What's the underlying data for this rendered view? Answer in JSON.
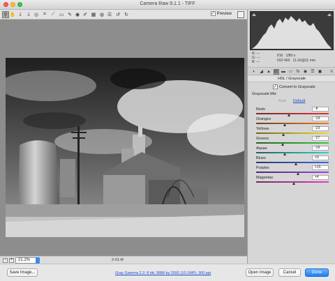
{
  "window": {
    "title": "Camera Raw 9.1.1  -  TIFF"
  },
  "toolbar": {
    "preview_label": "Preview",
    "preview_checked": true,
    "tools": [
      {
        "name": "zoom-tool",
        "glyph": "⚲"
      },
      {
        "name": "hand-tool",
        "glyph": "✋"
      },
      {
        "name": "white-balance-tool",
        "glyph": "⤓"
      },
      {
        "name": "color-sampler-tool",
        "glyph": "⤓"
      },
      {
        "name": "targeted-adjustment-tool",
        "glyph": "◎"
      },
      {
        "name": "crop-tool",
        "glyph": "⌗"
      },
      {
        "name": "straighten-tool",
        "glyph": "⟋"
      },
      {
        "name": "transform-tool",
        "glyph": "▭"
      },
      {
        "name": "spot-removal-tool",
        "glyph": "✎"
      },
      {
        "name": "red-eye-tool",
        "glyph": "◉"
      },
      {
        "name": "adjustment-brush-tool",
        "glyph": "✐"
      },
      {
        "name": "graduated-filter-tool",
        "glyph": "▦"
      },
      {
        "name": "radial-filter-tool",
        "glyph": "◍"
      },
      {
        "name": "preferences-tool",
        "glyph": "☰"
      },
      {
        "name": "rotate-left-tool",
        "glyph": "↺"
      },
      {
        "name": "rotate-right-tool",
        "glyph": "↻"
      }
    ]
  },
  "readout": {
    "r_label": "R:",
    "r_value": "---",
    "g_label": "G:",
    "g_value": "---",
    "b_label": "B:",
    "b_value": "---",
    "aperture": "f/16",
    "shutter": "1/80 s",
    "iso": "ISO 400",
    "lens": "11-16@11 mm"
  },
  "panel_tabs": [
    {
      "name": "basic-tab",
      "glyph": "◐"
    },
    {
      "name": "tone-curve-tab",
      "glyph": "◢"
    },
    {
      "name": "detail-tab",
      "glyph": "▲"
    },
    {
      "name": "hsl-grayscale-tab",
      "glyph": "▤"
    },
    {
      "name": "split-toning-tab",
      "glyph": "▬"
    },
    {
      "name": "lens-corrections-tab",
      "glyph": "▭"
    },
    {
      "name": "effects-tab",
      "glyph": "fx"
    },
    {
      "name": "camera-calibration-tab",
      "glyph": "◉"
    },
    {
      "name": "presets-tab",
      "glyph": "☰"
    },
    {
      "name": "snapshots-tab",
      "glyph": "▣"
    }
  ],
  "panel": {
    "section_title": "HSL / Grayscale",
    "convert_label": "Convert to Grayscale",
    "convert_checked": true,
    "mix_title": "Grayscale Mix",
    "auto_label": "Auto",
    "default_label": "Default"
  },
  "sliders": [
    {
      "label": "Reds",
      "value": "-8",
      "fraction": 0.46,
      "gradient": [
        "#7a2a2a",
        "#e53030"
      ]
    },
    {
      "label": "Oranges",
      "value": "-19",
      "fraction": 0.4,
      "gradient": [
        "#6e4120",
        "#f07a1a"
      ]
    },
    {
      "label": "Yellows",
      "value": "-23",
      "fraction": 0.38,
      "gradient": [
        "#6b6a1e",
        "#f0dc1e"
      ]
    },
    {
      "label": "Greens",
      "value": "-27",
      "fraction": 0.37,
      "gradient": [
        "#2c5e2a",
        "#36c83a"
      ]
    },
    {
      "label": "Aquas",
      "value": "-19",
      "fraction": 0.4,
      "gradient": [
        "#245e5e",
        "#2fd0d0"
      ]
    },
    {
      "label": "Blues",
      "value": "+9",
      "fraction": 0.55,
      "gradient": [
        "#283a6e",
        "#3366ee"
      ]
    },
    {
      "label": "Purples",
      "value": "+15",
      "fraction": 0.58,
      "gradient": [
        "#4a2a6e",
        "#9c40f0"
      ]
    },
    {
      "label": "Magentas",
      "value": "+4",
      "fraction": 0.52,
      "gradient": [
        "#6e2a5c",
        "#e83ac4"
      ]
    }
  ],
  "status": {
    "zoom": "21.2%",
    "filename": "2-01.tif"
  },
  "footer": {
    "save_label": "Save Image...",
    "workflow_link": "Gray Gamma 2.2; 8 bit; 3888 by 2592 (10.1MP); 300 ppi",
    "open_label": "Open Image",
    "cancel_label": "Cancel",
    "done_label": "Done"
  },
  "colors": {
    "accent": "#1f7ff0",
    "link": "#1a4fd0",
    "canvas_bg": "#8d8d8d",
    "histogram_bg": "#3b3b3b"
  }
}
